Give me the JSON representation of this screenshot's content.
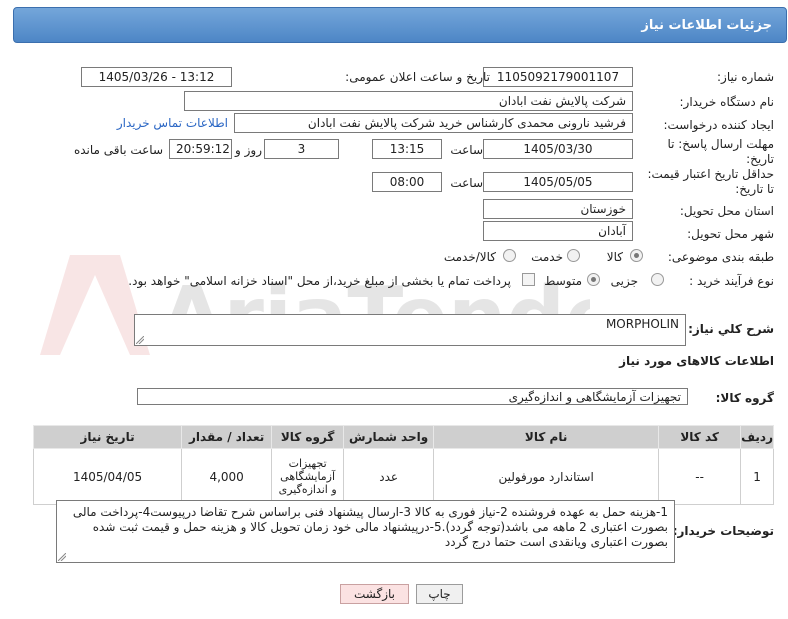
{
  "header": {
    "title": "جزئیات اطلاعات نیاز"
  },
  "form": {
    "need_number_label": "شماره نیاز:",
    "need_number": "1105092179001107",
    "announce_label": "تاریخ و ساعت اعلان عمومی:",
    "announce_value": "1405/03/26 - 13:12",
    "buyer_org_label": "نام دستگاه خریدار:",
    "buyer_org": "شرکت پالایش نفت ابادان",
    "requester_label": "ایجاد کننده درخواست:",
    "requester": "فرشید نارونی محمدی کارشناس خرید  شرکت پالایش نفت ابادان",
    "buyer_contact_link": "اطلاعات تماس خریدار",
    "reply_deadline_label": "مهلت ارسال پاسخ: تا تاریخ:",
    "reply_date": "1405/03/30",
    "time_label": "ساعت",
    "reply_time": "13:15",
    "days_value": "3",
    "days_label": "روز و",
    "remaining_time": "20:59:12",
    "remaining_label": "ساعت باقی مانده",
    "price_validity_label": "حداقل تاریخ اعتبار قیمت: تا تاریخ:",
    "price_validity_date": "1405/05/05",
    "price_validity_time": "08:00",
    "province_label": "استان محل تحویل:",
    "province": "خوزستان",
    "city_label": "شهر محل تحویل:",
    "city": "آبادان",
    "category_label": "طبقه بندی موضوعی:",
    "category_options": [
      "کالا",
      "خدمت",
      "کالا/خدمت"
    ],
    "category_selected": "کالا",
    "process_label": "نوع فرآیند خرید :",
    "process_options": [
      "جزیی",
      "متوسط"
    ],
    "process_selected": "جزیی",
    "payment_note": "پرداخت تمام یا بخشی از مبلغ خرید،از محل \"اسناد خزانه اسلامی\" خواهد بود."
  },
  "general_desc": {
    "label": "شرح کلي نياز:",
    "value": "MORPHOLIN"
  },
  "goods_info": {
    "title": "اطلاعات کالاهای مورد نیاز"
  },
  "goods_group": {
    "label": "گروه کالا:",
    "value": "تجهیزات آزمایشگاهی و اندازه‌گیری"
  },
  "table": {
    "headers": [
      "ردیف",
      "کد کالا",
      "نام کالا",
      "واحد شمارش",
      "گروه کالا",
      "تعداد / مقدار",
      "تاریخ نیاز"
    ],
    "rows": [
      {
        "row": "1",
        "code": "--",
        "name": "استاندارد مورفولین",
        "unit": "عدد",
        "group": "تجهیزات آزمایشگاهی و اندازه‌گیری",
        "qty": "4,000",
        "date": "1405/04/05"
      }
    ]
  },
  "buyer_notes": {
    "label": "توضیحات خریدار:",
    "value": "1-هزینه حمل به عهده فروشنده 2-نیاز فوری به کالا 3-ارسال پیشنهاد فنی براساس شرح تقاضا درپیوست4-پرداخت مالی بصورت اعتباری 2 ماهه می باشد(توجه گردد).5-درپیشنهاد مالی خود زمان تحویل کالا و هزینه حمل و قیمت ثبت شده بصورت اعتباری ویانقدی است حتما درج گردد"
  },
  "buttons": {
    "print": "چاپ",
    "back": "بازگشت"
  },
  "watermark": "AriaTender.net",
  "colors": {
    "title_bar": "#5b91cd",
    "link": "#2a66c4",
    "table_header": "#cfcfcf",
    "back_button": "#fbe2e2"
  }
}
